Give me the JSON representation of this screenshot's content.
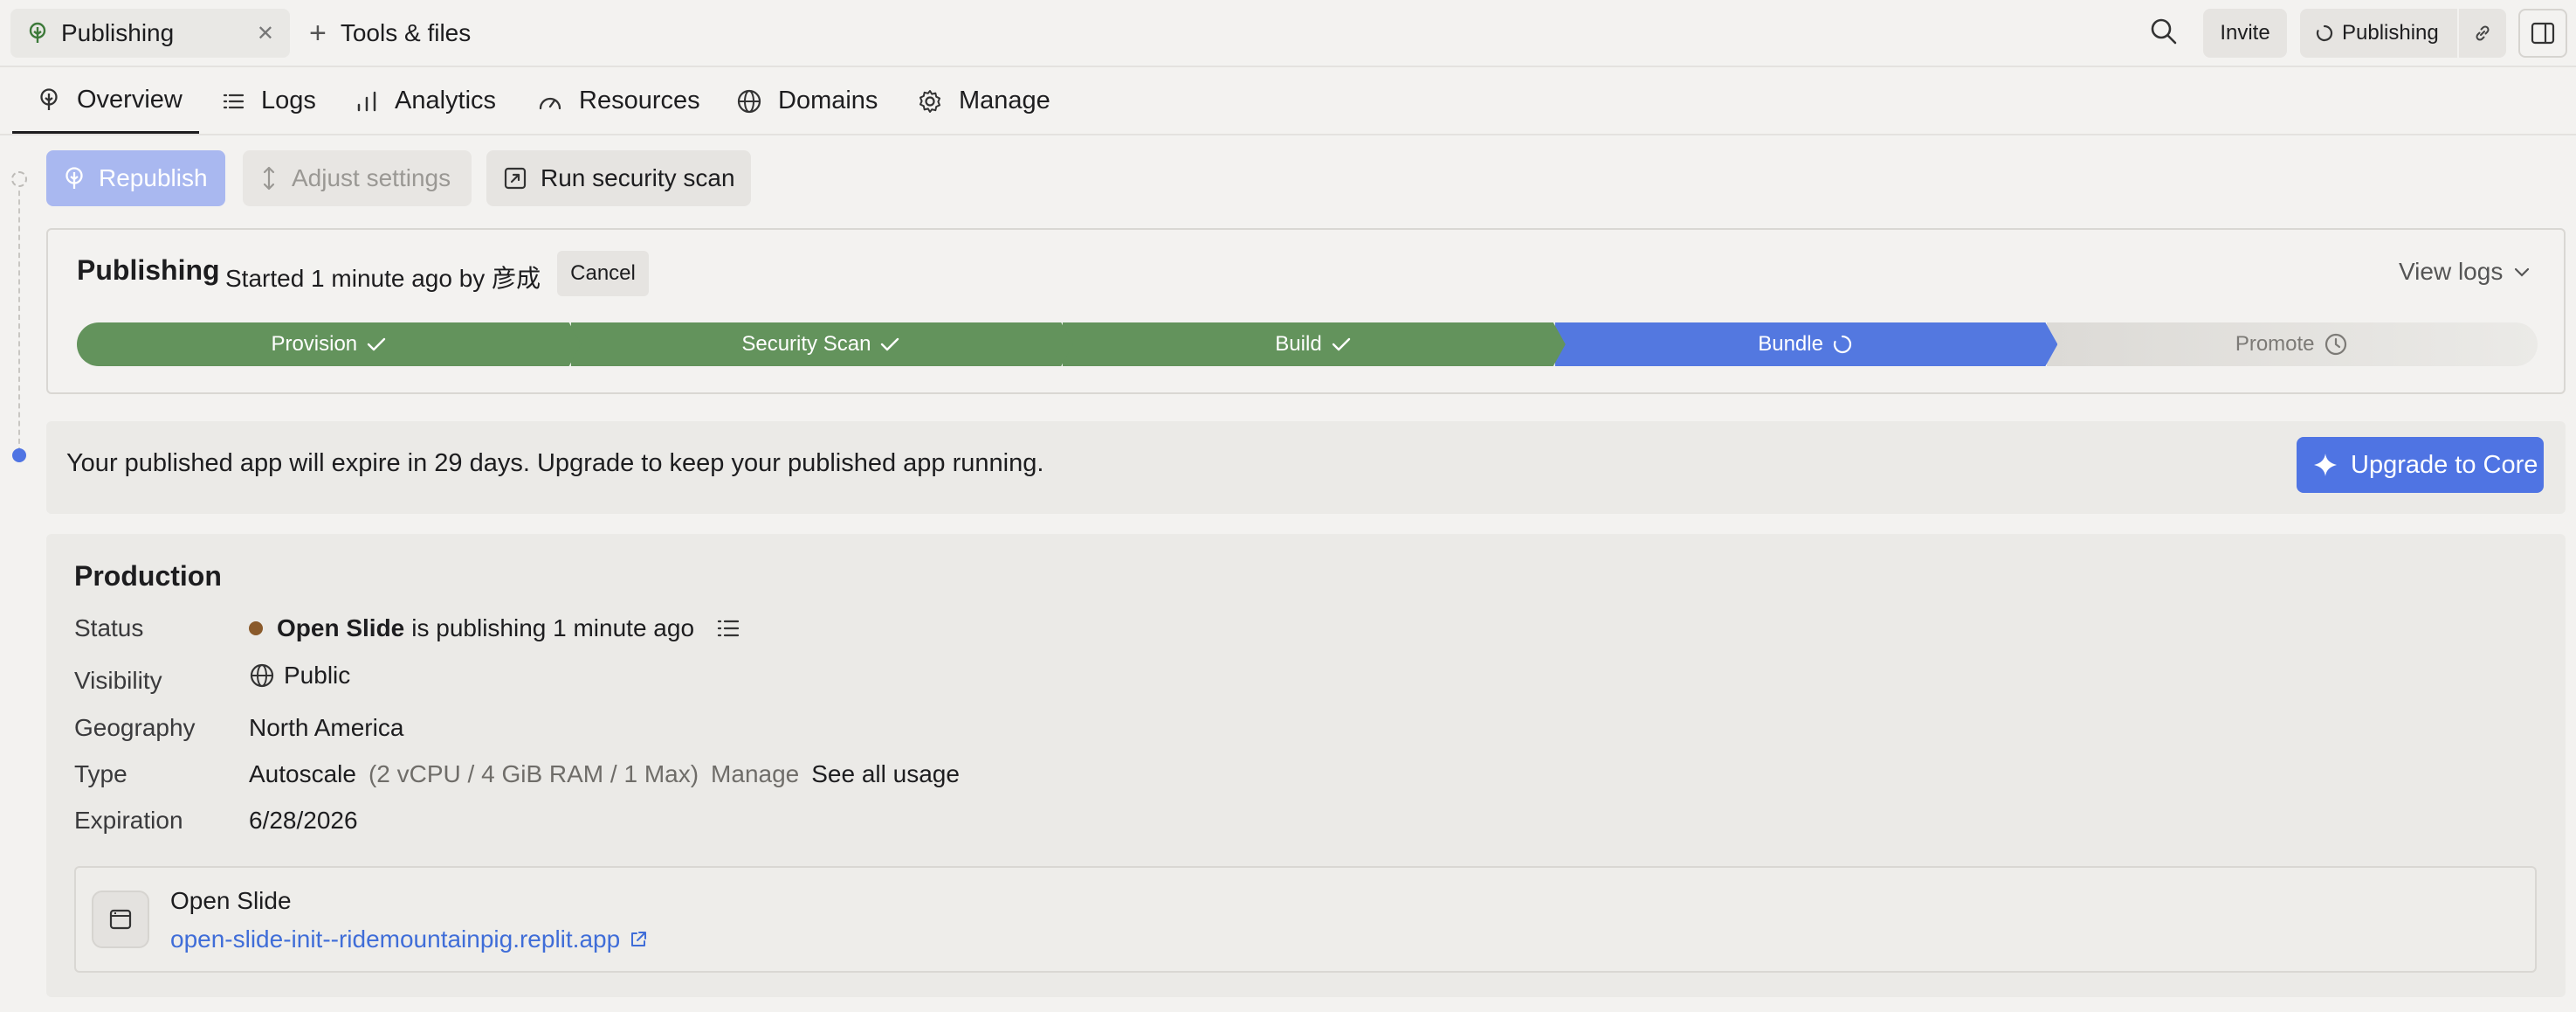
{
  "topbar": {
    "file_tab": "Publishing",
    "tools_tab": "Tools & files",
    "invite": "Invite",
    "publishing": "Publishing"
  },
  "nav": {
    "tabs": [
      {
        "label": "Overview"
      },
      {
        "label": "Logs"
      },
      {
        "label": "Analytics"
      },
      {
        "label": "Resources"
      },
      {
        "label": "Domains"
      },
      {
        "label": "Manage"
      }
    ]
  },
  "actions": {
    "republish": "Republish",
    "adjust": "Adjust settings",
    "scan": "Run security scan"
  },
  "publishing": {
    "title": "Publishing",
    "subtitle": "Started 1 minute ago by 彦成",
    "cancel": "Cancel",
    "view_logs": "View logs",
    "steps": [
      {
        "label": "Provision",
        "state": "done"
      },
      {
        "label": "Security Scan",
        "state": "done"
      },
      {
        "label": "Build",
        "state": "done"
      },
      {
        "label": "Bundle",
        "state": "active"
      },
      {
        "label": "Promote",
        "state": "pending"
      }
    ],
    "colors": {
      "done": "#63935c",
      "active": "#5378e0",
      "pending": "#dcdad6"
    }
  },
  "banner": {
    "text": "Your published app will expire in 29 days. Upgrade to keep your published app running.",
    "button": "Upgrade to Core"
  },
  "production": {
    "title": "Production",
    "status_label": "Status",
    "status_app": "Open Slide",
    "status_text": "is publishing 1 minute ago",
    "visibility_label": "Visibility",
    "visibility": "Public",
    "geography_label": "Geography",
    "geography": "North America",
    "type_label": "Type",
    "type": "Autoscale",
    "type_spec": "(2 vCPU / 4 GiB RAM / 1 Max)",
    "type_manage": "Manage",
    "type_usage": "See all usage",
    "expiration_label": "Expiration",
    "expiration": "6/28/2026",
    "app_name": "Open Slide",
    "app_url": "open-slide-init--ridemountainpig.replit.app"
  }
}
